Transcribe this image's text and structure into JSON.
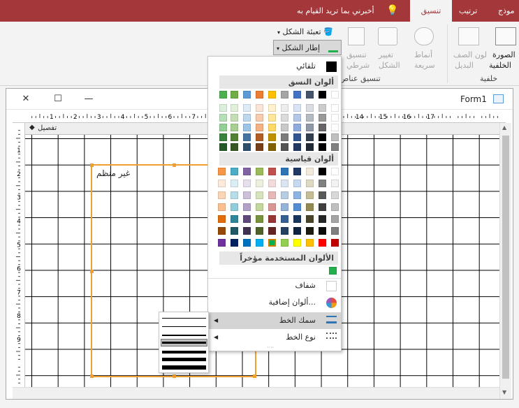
{
  "ribbon_tabs": [
    {
      "label": "موذج"
    },
    {
      "label": "ترتيب"
    },
    {
      "label": "تنسيق"
    }
  ],
  "tell_me": "أخبرني بما تريد القيام به",
  "ribbon": {
    "shape_fill": "تعبئة الشكل",
    "shape_outline": "إطار الشكل",
    "conditional_1": "تنسيق",
    "conditional_2": "شرطي",
    "change_shape_1": "تغيير",
    "change_shape_2": "الشكل",
    "quick_styles_1": "أنماط",
    "quick_styles_2": "سريعة",
    "alt_row_1": "لون الصف",
    "alt_row_2": "البديل",
    "bg_image_1": "الصورة",
    "bg_image_2": "الخلفية",
    "group_control_format": "تنسيق عناص",
    "group_background": "خلفية"
  },
  "form": {
    "title": "Form1",
    "section_label": "تفصيل",
    "label_text": "غير منظم"
  },
  "ruler_h": [
    "1",
    "2",
    "3",
    "4",
    "5",
    "6",
    "7",
    "8",
    "9",
    "10",
    "11",
    "12",
    "13",
    "14",
    "15",
    "16",
    "17"
  ],
  "ruler_v": [
    "1",
    "2",
    "3",
    "4",
    "5",
    "6",
    "7",
    "8",
    "9"
  ],
  "menu": {
    "automatic": "تلقائي",
    "theme_colors": "ألوان النسق",
    "standard_colors": "ألوان قياسية",
    "recent_colors": "الألوان المستخدمة مؤخراً",
    "transparent": "شفاف",
    "more_colors": "ألوان إضافية...",
    "line_thickness": "سمك الخط",
    "line_type": "نوع الخط"
  },
  "colors": {
    "accent": "#a4373a",
    "selection": "#f0a030",
    "recent": "#22b14c"
  },
  "theme_top": [
    "#ffffff",
    "#000000",
    "#44546a",
    "#4472c4",
    "#a5a5a5",
    "#ffc000",
    "#ed7d31",
    "#5b9bd5",
    "#70ad47",
    "#4caf50"
  ],
  "standard_rows": [
    [
      "#ffffff",
      "#000000",
      "#f2eadb",
      "#1f3864",
      "#2e75b6",
      "#c0504d",
      "#9bbb59",
      "#8064a2",
      "#4bacc6",
      "#f79646"
    ],
    [
      "#f2f2f2",
      "#7f7f7f",
      "#ddd9c3",
      "#c6d9f0",
      "#dbe5f1",
      "#f2dcdb",
      "#ebf1dd",
      "#e5e0ec",
      "#dbeef3",
      "#fdeada"
    ],
    [
      "#d8d8d8",
      "#595959",
      "#c4bd97",
      "#8db3e2",
      "#b8cce4",
      "#e5b9b7",
      "#d7e3bc",
      "#ccc1d9",
      "#b7dde8",
      "#fbd5b5"
    ],
    [
      "#bfbfbf",
      "#3f3f3f",
      "#938953",
      "#548dd4",
      "#95b3d7",
      "#d99694",
      "#c3d69b",
      "#b2a2c7",
      "#92cddc",
      "#fac08f"
    ],
    [
      "#a5a5a5",
      "#262626",
      "#494429",
      "#17365d",
      "#366092",
      "#953734",
      "#76923c",
      "#5f497a",
      "#31859b",
      "#e36c09"
    ],
    [
      "#7f7f7f",
      "#0c0c0c",
      "#1d1b10",
      "#0f243e",
      "#244061",
      "#632423",
      "#4f6128",
      "#3f3151",
      "#205867",
      "#974806"
    ],
    [
      "#c00000",
      "#ff0000",
      "#ffc000",
      "#ffff00",
      "#92d050",
      "#00b050",
      "#00b0f0",
      "#0070c0",
      "#002060",
      "#7030a0"
    ]
  ]
}
